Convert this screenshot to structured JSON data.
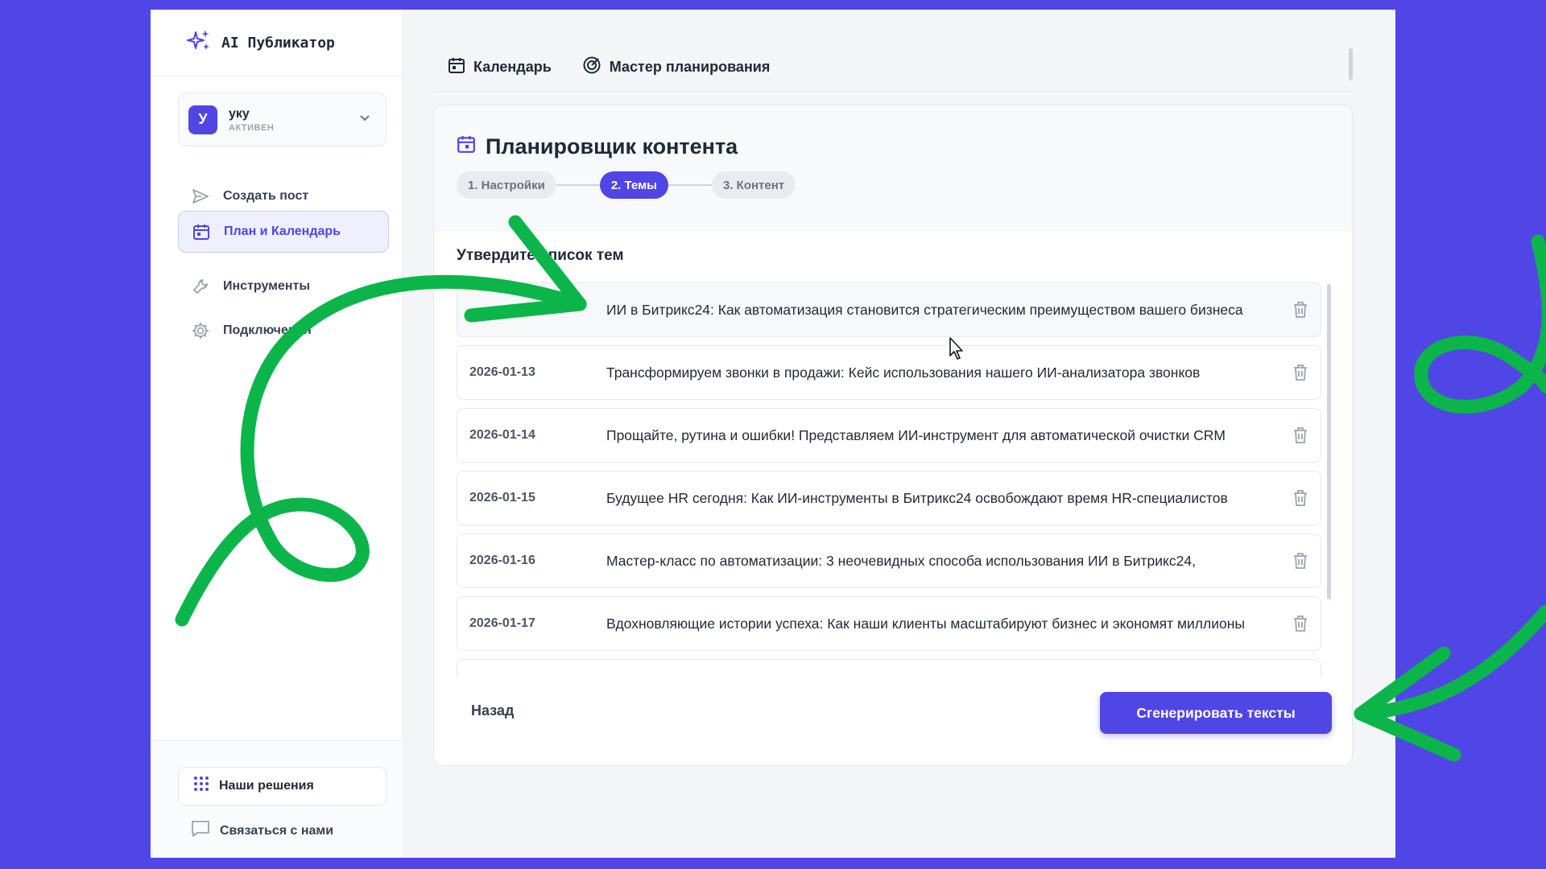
{
  "brand": {
    "name": "AI Публикатор",
    "icon": "sparkles-icon"
  },
  "workspace": {
    "avatar_letter": "У",
    "name": "уку",
    "status": "АКТИВЕН"
  },
  "nav": {
    "items": [
      {
        "label": "Создать пост",
        "icon": "send-icon",
        "active": false
      },
      {
        "label": "План и Календарь",
        "icon": "calendar-icon",
        "active": true
      },
      {
        "label": "Инструменты",
        "icon": "wrench-icon",
        "active": false
      },
      {
        "label": "Подключения",
        "icon": "gear-icon",
        "active": false
      }
    ]
  },
  "footer": {
    "solutions_label": "Наши решения",
    "contact_label": "Связаться с нами"
  },
  "tabs": [
    {
      "label": "Календарь",
      "icon": "calendar-icon"
    },
    {
      "label": "Мастер планирования",
      "icon": "target-icon"
    }
  ],
  "planner": {
    "title": "Планировщик контента",
    "steps": [
      {
        "label": "1. Настройки",
        "active": false
      },
      {
        "label": "2. Темы",
        "active": true
      },
      {
        "label": "3. Контент",
        "active": false
      }
    ],
    "list_heading": "Утвердите список тем",
    "topics": [
      {
        "date": "",
        "text": "ИИ в Битрикс24: Как автоматизация становится стратегическим преимуществом вашего бизнеса"
      },
      {
        "date": "2026-01-13",
        "text": "Трансформируем звонки в продажи: Кейс использования нашего ИИ-анализатора звонков"
      },
      {
        "date": "2026-01-14",
        "text": "Прощайте, рутина и ошибки! Представляем ИИ-инструмент для автоматической очистки CRM"
      },
      {
        "date": "2026-01-15",
        "text": "Будущее HR сегодня: Как ИИ-инструменты в Битрикс24 освобождают время HR-специалистов"
      },
      {
        "date": "2026-01-16",
        "text": "Мастер-класс по автоматизации: 3 неочевидных способа использования ИИ в Битрикс24,"
      },
      {
        "date": "2026-01-17",
        "text": "Вдохновляющие истории успеха: Как наши клиенты масштабируют бизнес и экономят миллионы"
      }
    ],
    "back_label": "Назад",
    "generate_label": "Сгенерировать тексты"
  },
  "colors": {
    "background": "#5046e5",
    "accent": "#4f46e5",
    "arrow": "#0bb54a"
  }
}
